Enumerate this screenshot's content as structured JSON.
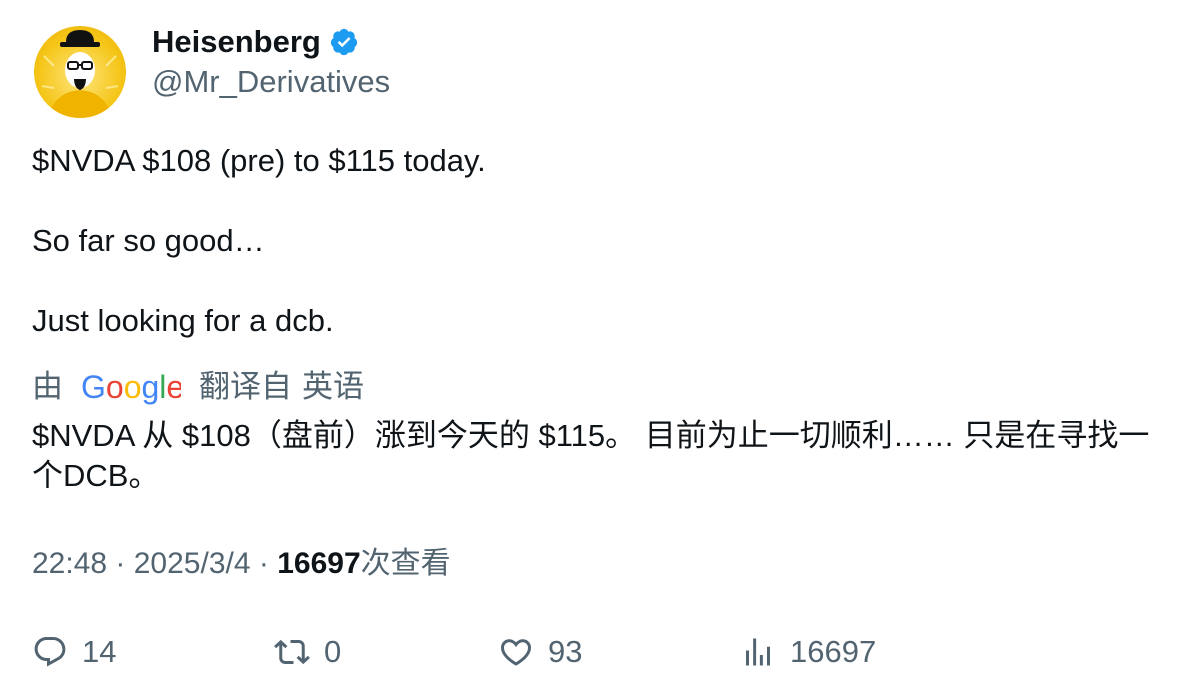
{
  "author": {
    "display_name": "Heisenberg",
    "handle": "@Mr_Derivatives",
    "verified_color": "#1d9bf0"
  },
  "tweet": {
    "lines": [
      "$NVDA $108 (pre) to $115 today.",
      "So far so good…",
      "Just looking for a dcb."
    ]
  },
  "translation": {
    "prefix": "由",
    "provider": "Google",
    "suffix": "翻译自",
    "language": "英语",
    "text": "$NVDA 从 $108（盘前）涨到今天的 $115。 目前为止一切顺利…… 只是在寻找一个DCB。"
  },
  "meta": {
    "time": "22:48",
    "separator": " · ",
    "date": "2025/3/4",
    "views_count": "16697",
    "views_label": "次查看"
  },
  "actions": {
    "replies": "14",
    "retweets": "0",
    "likes": "93",
    "views": "16697"
  },
  "colors": {
    "text_primary": "#0f1419",
    "text_secondary": "#536471",
    "avatar_bg": "#f5c518"
  }
}
